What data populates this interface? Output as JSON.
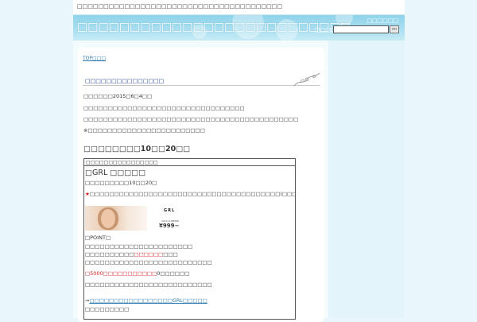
{
  "topbar": {
    "tagline": "□□□□□□□□□□□□□□□□□□□□□□□□□□□□□□□□□□□□□□□"
  },
  "header": {
    "site_title": "□□□□□□□□□□□□□□□□□□□□□□□□□□",
    "sitemap_label": "□□□□□□",
    "search_label": "□□□□□□",
    "search_value": "",
    "search_button": "□□"
  },
  "breadcrumb": "TOP□□□",
  "article": {
    "title": "□□□□□□□□□□□□□□□",
    "date_line": "□□□□□□2015□6□4□□",
    "p1": "□□□□□□□□□□□□□□□□□□□□□□□□□□□□□□□□□",
    "p2": "□□□□□□□□□□□□□□□□□□□□□□□□□□□□□□□□□□□□□□□□□□□□",
    "p3": "※□□□□□□□□□□□□□□□□□□□□□□□□",
    "heading": "□□□□□□□□10□□20□□"
  },
  "box": {
    "header": "□□□□□□□□□□□□□□□□",
    "brand_title": "□GRL □□□□□",
    "date": "□□□□□□□□□10□□20□",
    "star1": "★",
    "star_text": "□□□□□□□□□□□□□□□□□□□□□□□□□□□□□□□□□□□□□□□(□□□□)□□□□□□□□□□□□□□□□□□□□□□□",
    "star2": "★",
    "ad_logo": "GRL",
    "ad_small": "2015 SUMMER",
    "ad_price": "¥999~",
    "point_label": "□POINT□",
    "line1": "□□□□□□□□□□□□□□□□□□□□□□",
    "line2_a": "□□□□□□□□□□",
    "line2_red": "□□□□□□",
    "line2_b": "□□□",
    "line3": "□□□□□□□□□□□□□□□□□□□□□□□□□□",
    "line4_red": "□5000□□□□□□□□□□□",
    "line4_b": "0□□□□□□",
    "line5": "□□□□□□□□□□□□□□□□□□□□□□□□□□",
    "link_prefix": "⇒",
    "link_text": "□□□□□□□□□□□□□□□□□GRL□□□□□",
    "last": "□□□□□□□□□"
  }
}
